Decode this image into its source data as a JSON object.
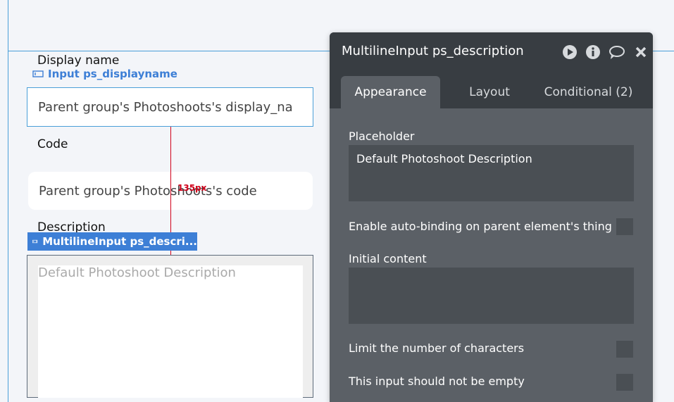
{
  "canvas": {
    "display_name_label": "Display name",
    "display_name_element": "Input ps_displayname",
    "display_name_value": "Parent group's Photoshoots's display_na",
    "code_label": "Code",
    "code_value": "Parent group's Photoshoots's code",
    "distance_label": "135px",
    "description_label": "Description",
    "selected_element_tag": "MultilineInput ps_descri...",
    "multiline_placeholder": "Default Photoshoot Description"
  },
  "panel": {
    "title": "MultilineInput ps_description",
    "icons": [
      "play-icon",
      "info-icon",
      "comment-icon",
      "close-icon"
    ],
    "tabs": [
      "Appearance",
      "Layout",
      "Conditional (2)"
    ],
    "active_tab": "Appearance",
    "placeholder_label": "Placeholder",
    "placeholder_value": "Default Photoshoot Description",
    "autobinding_label": "Enable auto-binding on parent element's thing",
    "initial_content_label": "Initial content",
    "initial_content_value": "",
    "limit_chars_label": "Limit the number of characters",
    "not_empty_label": "This input should not be empty"
  },
  "colors": {
    "accent": "#3d7fd6",
    "distance_marker": "#d0021b",
    "panel_bg": "#5b6066",
    "panel_header": "#383d42"
  }
}
